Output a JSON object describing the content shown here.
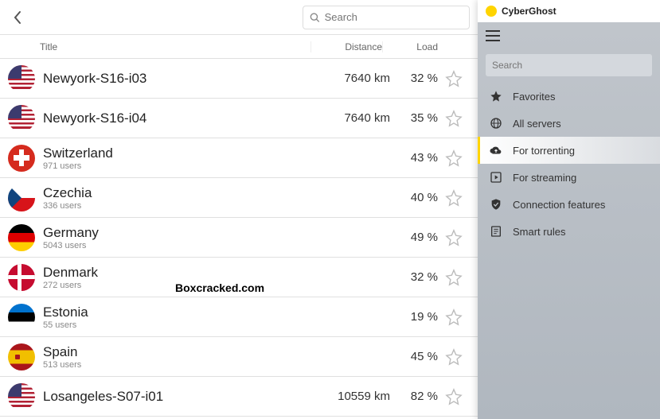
{
  "brand": "CyberGhost",
  "main": {
    "search_placeholder": "Search",
    "columns": {
      "title": "Title",
      "distance": "Distance",
      "load": "Load"
    },
    "servers": [
      {
        "flag": "us",
        "name": "Newyork-S16-i03",
        "sub": "",
        "distance": "7640 km",
        "load": "32 %"
      },
      {
        "flag": "us",
        "name": "Newyork-S16-i04",
        "sub": "",
        "distance": "7640 km",
        "load": "35 %"
      },
      {
        "flag": "ch",
        "name": "Switzerland",
        "sub": "971 users",
        "distance": "",
        "load": "43 %"
      },
      {
        "flag": "cz",
        "name": "Czechia",
        "sub": "336 users",
        "distance": "",
        "load": "40 %"
      },
      {
        "flag": "de",
        "name": "Germany",
        "sub": "5043 users",
        "distance": "",
        "load": "49 %"
      },
      {
        "flag": "dk",
        "name": "Denmark",
        "sub": "272 users",
        "distance": "",
        "load": "32 %"
      },
      {
        "flag": "ee",
        "name": "Estonia",
        "sub": "55 users",
        "distance": "",
        "load": "19 %"
      },
      {
        "flag": "es",
        "name": "Spain",
        "sub": "513 users",
        "distance": "",
        "load": "45 %"
      },
      {
        "flag": "us",
        "name": "Losangeles-S07-i01",
        "sub": "",
        "distance": "10559 km",
        "load": "82 %"
      }
    ]
  },
  "sidebar": {
    "search_placeholder": "Search",
    "items": [
      {
        "icon": "star",
        "label": "Favorites",
        "active": false
      },
      {
        "icon": "globe",
        "label": "All servers",
        "active": false
      },
      {
        "icon": "cloud",
        "label": "For torrenting",
        "active": true
      },
      {
        "icon": "play",
        "label": "For streaming",
        "active": false
      },
      {
        "icon": "shield",
        "label": "Connection features",
        "active": false
      },
      {
        "icon": "rules",
        "label": "Smart rules",
        "active": false
      }
    ]
  },
  "watermark": "Boxcracked.com"
}
